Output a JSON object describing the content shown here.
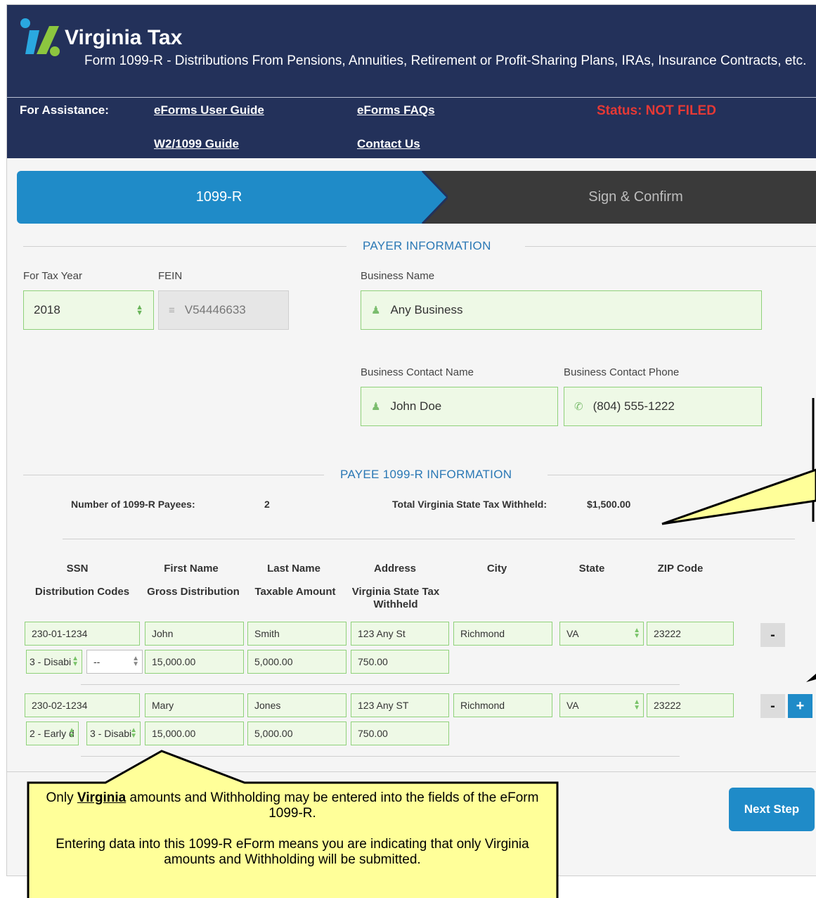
{
  "header": {
    "brand": "Virginia Tax",
    "subtitle": "Form 1099-R - Distributions From Pensions, Annuities, Retirement or Profit-Sharing Plans, IRAs, Insurance Contracts, etc.",
    "assistance_label": "For Assistance:",
    "links": {
      "user_guide": "eForms User Guide",
      "faqs": "eForms FAQs",
      "w2_guide": "W2/1099 Guide",
      "contact": "Contact Us"
    },
    "status": "Status: NOT FILED"
  },
  "steps": {
    "step1": "1099-R",
    "step2": "Sign & Confirm"
  },
  "payer": {
    "section_title": "PAYER INFORMATION",
    "tax_year_label": "For Tax Year",
    "tax_year_value": "2018",
    "fein_label": "FEIN",
    "fein_value": "V54446633",
    "business_name_label": "Business Name",
    "business_name_value": "Any Business",
    "contact_name_label": "Business Contact Name",
    "contact_name_value": "John Doe",
    "contact_phone_label": "Business Contact Phone",
    "contact_phone_value": "(804) 555-1222"
  },
  "payee": {
    "section_title": "PAYEE 1099-R INFORMATION",
    "count_label": "Number of 1099-R Payees:",
    "count_value": "2",
    "total_label": "Total Virginia State Tax Withheld:",
    "total_value": "$1,500.00",
    "headers_row1": [
      "SSN",
      "First Name",
      "Last Name",
      "Address",
      "City",
      "State",
      "ZIP Code"
    ],
    "headers_row2": [
      "Distribution Codes",
      "Gross Distribution",
      "Taxable Amount",
      "Virginia State Tax Withheld"
    ],
    "rows": [
      {
        "ssn": "230-01-1234",
        "first": "John",
        "last": "Smith",
        "address": "123 Any St",
        "city": "Richmond",
        "state": "VA",
        "zip": "23222",
        "code1": "3 - Disabi",
        "code2": "--",
        "gross": "15,000.00",
        "taxable": "5,000.00",
        "withheld": "750.00"
      },
      {
        "ssn": "230-02-1234",
        "first": "Mary",
        "last": "Jones",
        "address": "123 Any ST",
        "city": "Richmond",
        "state": "VA",
        "zip": "23222",
        "code1": "2 - Early d",
        "code2": "3 - Disabi",
        "gross": "15,000.00",
        "taxable": "5,000.00",
        "withheld": "750.00"
      }
    ],
    "minus_label": "-",
    "plus_label": "+"
  },
  "next_button": "Next Step",
  "callout": {
    "line1_pre": "Only ",
    "line1_bold": "Virginia",
    "line1_post": " amounts and Withholding may be entered into the fields of the eForm 1099-R.",
    "line2": "Entering data into this 1099-R eForm means you are indicating that only Virginia amounts and Withholding will be submitted."
  },
  "colors": {
    "header_bg": "#23315a",
    "accent_blue": "#1f8bc8",
    "status_red": "#e53935",
    "field_green_bg": "#eef9e6",
    "field_green_border": "#8fd17a",
    "callout_yellow": "#ffff99"
  }
}
